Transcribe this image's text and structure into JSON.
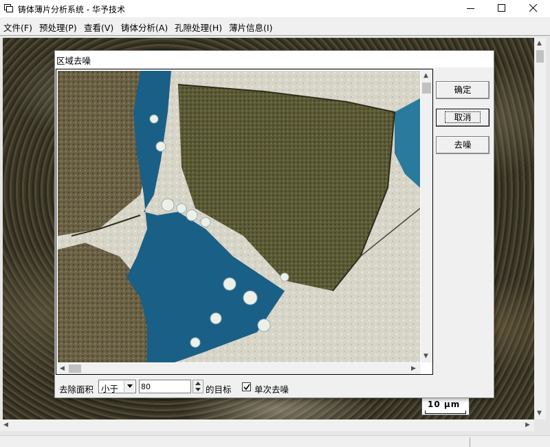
{
  "window": {
    "title": "铸体薄片分析系统 - 华予技术",
    "minimize_icon": "minimize-icon",
    "maximize_icon": "maximize-icon",
    "close_icon": "close-icon"
  },
  "menu": {
    "items": [
      {
        "label": "文件(F)"
      },
      {
        "label": "预处理(P)"
      },
      {
        "label": "查看(V)"
      },
      {
        "label": "铸体分析(A)"
      },
      {
        "label": "孔隙处理(H)"
      },
      {
        "label": "薄片信息(I)"
      }
    ]
  },
  "scale_bar": {
    "label": "10 μm"
  },
  "dialog": {
    "title": "区域去噪",
    "buttons": {
      "ok": "确定",
      "cancel": "取消",
      "denoise": "去噪"
    },
    "area_label": "去除面积",
    "comparison": {
      "selected": "小于"
    },
    "area_value": "80",
    "target_label": "的目标",
    "single_denoise": {
      "label": "单次去噪",
      "checked": true
    }
  },
  "colors": {
    "pore_blue": "#1a5f86",
    "grain_olive": "#5b5a36",
    "quartz_light": "#d9d6c9"
  }
}
